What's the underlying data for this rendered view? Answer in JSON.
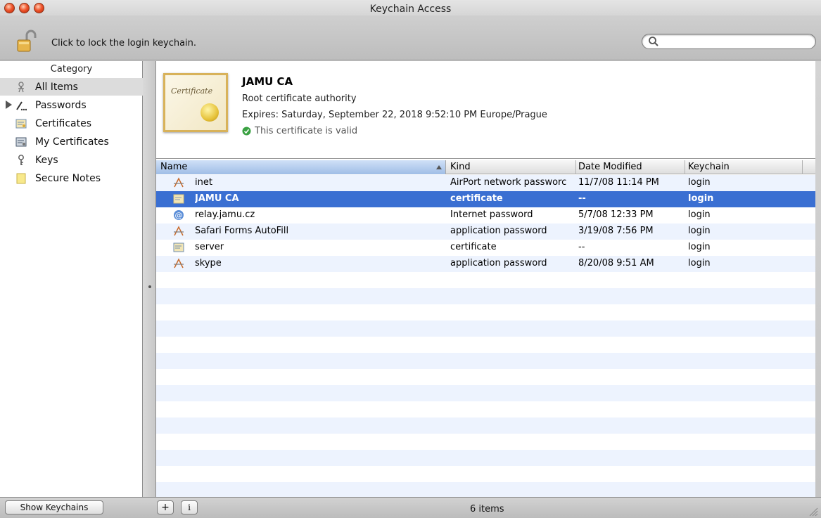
{
  "window": {
    "title": "Keychain Access"
  },
  "toolbar": {
    "lock_label": "Click to lock the login keychain.",
    "lock_icon": "padlock-open-icon",
    "search": {
      "value": "",
      "placeholder": "",
      "icon": "magnifier-icon"
    }
  },
  "sidebar": {
    "header": "Category",
    "items": [
      {
        "label": "All Items",
        "icon": "all-items-icon",
        "selected": true
      },
      {
        "label": "Passwords",
        "icon": "passwords-icon",
        "expandable": true
      },
      {
        "label": "Certificates",
        "icon": "certificate-icon"
      },
      {
        "label": "My Certificates",
        "icon": "my-certificate-icon"
      },
      {
        "label": "Keys",
        "icon": "key-icon"
      },
      {
        "label": "Secure Notes",
        "icon": "note-icon"
      }
    ]
  },
  "info": {
    "title": "JAMU CA",
    "subtitle": "Root certificate authority",
    "expires": "Expires: Saturday, September 22, 2018 9:52:10 PM Europe/Prague",
    "status": "This certificate is valid",
    "thumb_text": "Certificate"
  },
  "table": {
    "columns": [
      "Name",
      "Kind",
      "Date Modified",
      "Keychain"
    ],
    "sorted_by": "Name",
    "rows": [
      {
        "name": "inet",
        "kind": "AirPort network passworc",
        "date": "11/7/08 11:14 PM",
        "keychain": "login",
        "icon": "password-icon"
      },
      {
        "name": "JAMU CA",
        "kind": "certificate",
        "date": "--",
        "keychain": "login",
        "icon": "certificate-icon",
        "selected": true
      },
      {
        "name": "relay.jamu.cz",
        "kind": "Internet password",
        "date": "5/7/08 12:33 PM",
        "keychain": "login",
        "icon": "at-sign-icon"
      },
      {
        "name": "Safari Forms AutoFill",
        "kind": "application password",
        "date": "3/19/08 7:56 PM",
        "keychain": "login",
        "icon": "password-icon"
      },
      {
        "name": "server",
        "kind": "certificate",
        "date": "--",
        "keychain": "login",
        "icon": "certificate-icon"
      },
      {
        "name": "skype",
        "kind": "application password",
        "date": "8/20/08 9:51 AM",
        "keychain": "login",
        "icon": "password-icon"
      }
    ]
  },
  "bottom": {
    "show_keychains_label": "Show Keychains",
    "add_label": "+",
    "info_label": "i",
    "item_count": "6 items"
  },
  "colors": {
    "selection": "#3a6fd2",
    "stripe": "#edf3fe",
    "traffic_light": "#f0562d"
  }
}
